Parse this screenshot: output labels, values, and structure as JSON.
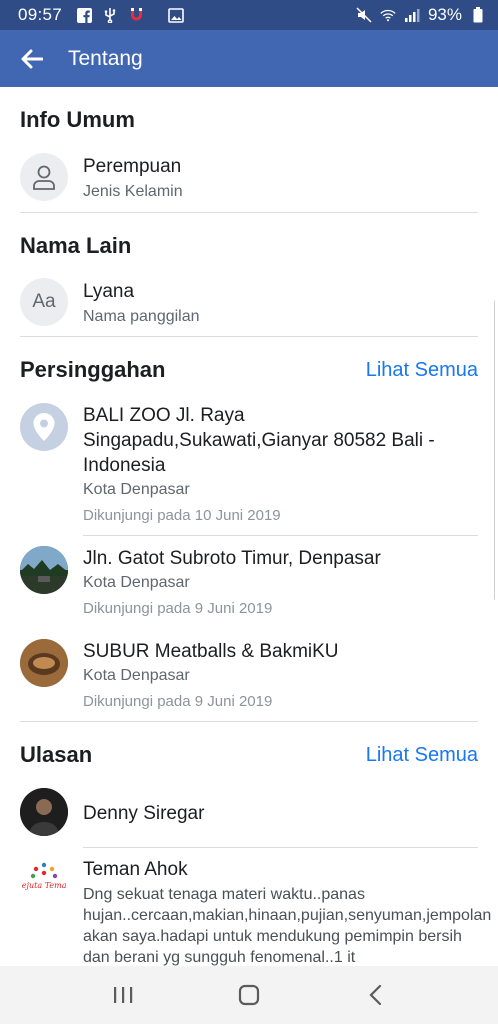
{
  "status_bar": {
    "time": "09:57",
    "battery": "93%",
    "icons_left": [
      "facebook-icon",
      "usb-icon",
      "magnet-icon",
      "image-icon"
    ],
    "icons_right": [
      "mute-icon",
      "wifi-icon",
      "signal-icon",
      "battery-icon"
    ]
  },
  "app_bar": {
    "title": "Tentang"
  },
  "sections": {
    "info_umum": {
      "title": "Info Umum",
      "item": {
        "value": "Perempuan",
        "label": "Jenis Kelamin"
      }
    },
    "nama_lain": {
      "title": "Nama Lain",
      "icon_text": "Aa",
      "item": {
        "value": "Lyana",
        "label": "Nama panggilan"
      }
    },
    "persinggahan": {
      "title": "Persinggahan",
      "see_all": "Lihat Semua",
      "items": [
        {
          "title": "BALI ZOO Jl. Raya Singapadu,Sukawati,Gianyar 80582 Bali - Indonesia",
          "city": "Kota Denpasar",
          "visited": "Dikunjungi pada 10 Juni 2019"
        },
        {
          "title": "Jln. Gatot Subroto Timur, Denpasar",
          "city": "Kota Denpasar",
          "visited": "Dikunjungi pada 9 Juni 2019"
        },
        {
          "title": "SUBUR Meatballs & BakmiKU",
          "city": "Kota Denpasar",
          "visited": "Dikunjungi pada 9 Juni 2019"
        }
      ]
    },
    "ulasan": {
      "title": "Ulasan",
      "see_all": "Lihat Semua",
      "items": [
        {
          "name": "Denny Siregar"
        },
        {
          "name": "Teman Ahok",
          "logo_text": "Sejuta Teman",
          "text": "Dng sekuat tenaga materi waktu..panas hujan..cercaan,makian,hinaan,pujian,senyuman,jempolan akan saya.hadapi untuk mendukung pemimpin bersih dan berani yg sungguh fenomenal..1 it"
        }
      ]
    }
  },
  "colors": {
    "status_bar": "#2f4c86",
    "app_bar": "#4267b2",
    "link": "#1877f2"
  }
}
